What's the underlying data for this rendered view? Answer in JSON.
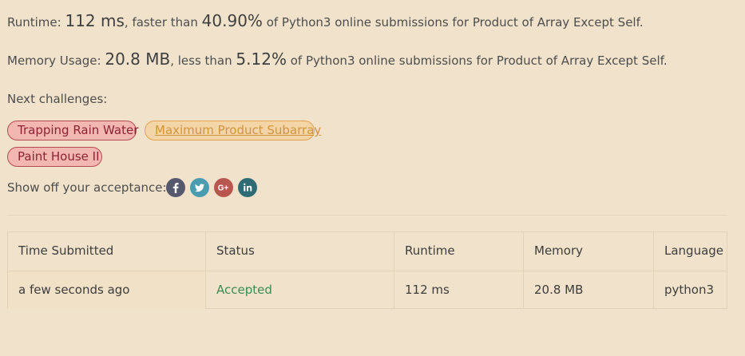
{
  "result": {
    "runtime_label": "Runtime: ",
    "runtime_value": "112 ms",
    "runtime_mid": ", faster than ",
    "runtime_percent": "40.90%",
    "runtime_suffix": " of Python3 online submissions for Product of Array Except Self.",
    "memory_label": "Memory Usage: ",
    "memory_value": "20.8 MB",
    "memory_mid": ", less than ",
    "memory_percent": "5.12%",
    "memory_suffix": " of Python3 online submissions for Product of Array Except Self."
  },
  "next_challenges": {
    "label": "Next challenges:",
    "items": [
      {
        "title": "Trapping Rain Water",
        "difficulty": "hard"
      },
      {
        "title": "Maximum Product Subarray",
        "difficulty": "medium"
      },
      {
        "title": "Paint House II",
        "difficulty": "hard"
      }
    ]
  },
  "share": {
    "label": "Show off your acceptance:",
    "icons": [
      "facebook-icon",
      "twitter-icon",
      "google-plus-icon",
      "linkedin-icon"
    ]
  },
  "submissions": {
    "headers": [
      "Time Submitted",
      "Status",
      "Runtime",
      "Memory",
      "Language"
    ],
    "rows": [
      {
        "time": "a few seconds ago",
        "status": "Accepted",
        "runtime": "112 ms",
        "memory": "20.8 MB",
        "language": "python3"
      }
    ]
  },
  "colors": {
    "background": "#f1e3cb",
    "hard_chip": "#f3b7b1",
    "medium_chip": "#f4d5a8",
    "accepted": "#3d8a56"
  }
}
